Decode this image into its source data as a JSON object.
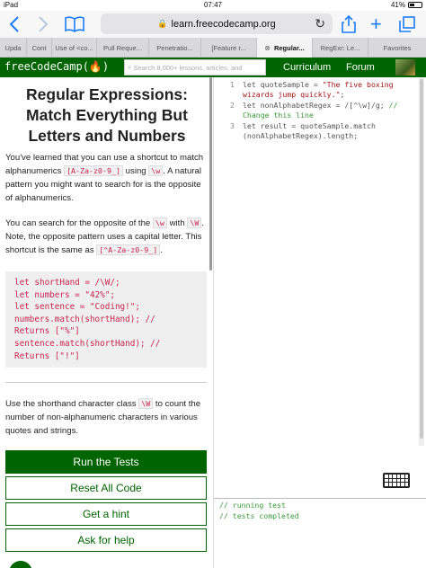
{
  "status_bar": {
    "device": "iPad",
    "time": "07:47",
    "battery": "41%"
  },
  "browser": {
    "url": "learn.freecodecamp.org",
    "tabs": [
      {
        "label": "Upda"
      },
      {
        "label": "Cont"
      },
      {
        "label": "Use of <co..."
      },
      {
        "label": "Pull Reque..."
      },
      {
        "label": "Penetratio..."
      },
      {
        "label": "[Feature r..."
      },
      {
        "label": "Regular...",
        "active": true
      },
      {
        "label": "RegExr: Le..."
      },
      {
        "label": "Favorites"
      }
    ]
  },
  "nav": {
    "logo": "freeCodeCamp(🔥)",
    "search_placeholder": "Search 8,000+ lessons, articles, and",
    "links": [
      "Curriculum",
      "Forum"
    ]
  },
  "lesson": {
    "title": "Regular Expressions: Match Everything But Letters and Numbers",
    "p1": {
      "t1": "You've learned that you can use a shortcut to match alphanumerics ",
      "c1": "[A-Za-z0-9_]",
      "t2": " using ",
      "c2": "\\w",
      "t3": ". A natural pattern you might want to search for is the opposite of alphanumerics."
    },
    "p2": {
      "t1": "You can search for the opposite of the ",
      "c1": "\\w",
      "t2": " with ",
      "c2": "\\W",
      "t3": ". Note, the opposite pattern uses a capital letter. This shortcut is the same as ",
      "c3": "[^A-Za-z0-9_]",
      "t4": "."
    },
    "code_example": "let shortHand = /\\W/;\nlet numbers = \"42%\";\nlet sentence = \"Coding!\";\nnumbers.match(shortHand); //\nReturns [\"%\"]\nsentence.match(shortHand); //\nReturns [\"!\"]",
    "p3": {
      "t1": "Use the shorthand character class ",
      "c1": "\\W",
      "t2": " to count the number of non-alphanumeric characters in various quotes and strings."
    },
    "buttons": {
      "run": "Run the Tests",
      "reset": "Reset All Code",
      "hint": "Get a hint",
      "help": "Ask for help"
    }
  },
  "editor": {
    "line_numbers": [
      "1",
      "2",
      "3"
    ],
    "l1a": "let quoteSample = ",
    "l1b": "\"The five boxing",
    "l1c": "wizards jump quickly.\"",
    "l1d": ";",
    "l2a": "let nonAlphabetRegex = /[^\\w]/g; ",
    "l2b": "//",
    "l2c": "Change this line",
    "l3a": "let result = quoteSample.match",
    "l3b": "(nonAlphabetRegex).length;"
  },
  "output": {
    "lines": [
      "// running test",
      "// tests completed"
    ]
  }
}
